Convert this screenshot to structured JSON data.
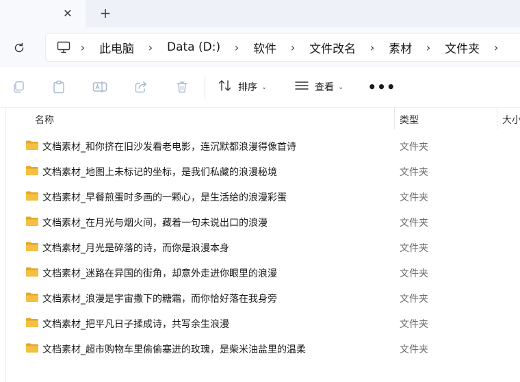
{
  "tabstrip": {
    "close_glyph": "✕",
    "new_tab_glyph": "+"
  },
  "breadcrumb": [
    "此电脑",
    "Data (D:)",
    "软件",
    "文件改名",
    "素材",
    "文件夹"
  ],
  "commandbar": {
    "sort_label": "排序",
    "view_label": "查看",
    "more_glyph": "•••"
  },
  "columns": {
    "name": "名称",
    "type": "类型",
    "size": "大小"
  },
  "files": [
    {
      "name": "文档素材_和你挤在旧沙发看老电影，连沉默都浪漫得像首诗",
      "type": "文件夹"
    },
    {
      "name": "文档素材_地图上未标记的坐标，是我们私藏的浪漫秘境",
      "type": "文件夹"
    },
    {
      "name": "文档素材_早餐煎蛋时多画的一颗心，是生活给的浪漫彩蛋",
      "type": "文件夹"
    },
    {
      "name": "文档素材_在月光与烟火间，藏着一句未说出口的浪漫",
      "type": "文件夹"
    },
    {
      "name": "文档素材_月光是碎落的诗，而你是浪漫本身",
      "type": "文件夹"
    },
    {
      "name": "文档素材_迷路在异国的街角，却意外走进你眼里的浪漫",
      "type": "文件夹"
    },
    {
      "name": "文档素材_浪漫是宇宙撒下的糖霜，而你恰好落在我身旁",
      "type": "文件夹"
    },
    {
      "name": "文档素材_把平凡日子揉成诗，共写余生浪漫",
      "type": "文件夹"
    },
    {
      "name": "文档素材_超市购物车里偷偷塞进的玫瑰，是柴米油盐里的温柔",
      "type": "文件夹"
    }
  ],
  "colors": {
    "folder_yellow": "#f4c042",
    "folder_dark": "#e2a82a",
    "tabstrip_bg": "#eef2f8",
    "type_text": "#6b6b6b"
  },
  "icons": [
    "close-icon",
    "plus-icon",
    "refresh-icon",
    "this-pc-icon",
    "chevron-right-icon",
    "copy-icon",
    "paste-icon",
    "rename-icon",
    "share-icon",
    "delete-icon",
    "sort-icon",
    "view-icon",
    "more-icon",
    "folder-icon"
  ]
}
